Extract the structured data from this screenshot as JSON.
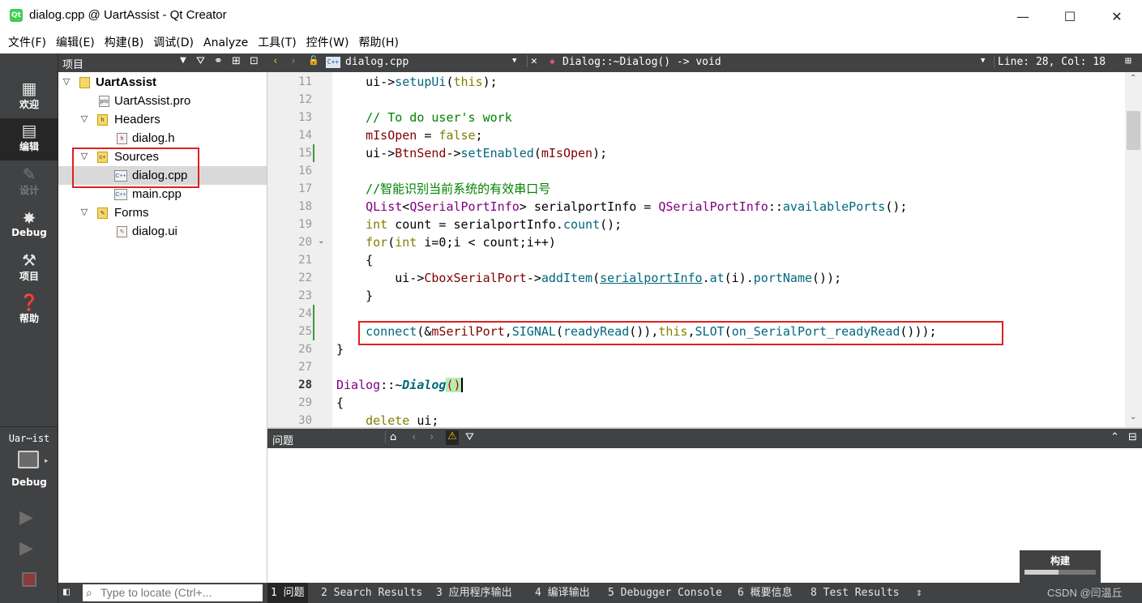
{
  "window": {
    "title": "dialog.cpp @ UartAssist - Qt Creator",
    "app_icon": "Qt",
    "minimize": "—",
    "maximize": "☐",
    "close": "✕"
  },
  "menu": [
    "文件(F)",
    "编辑(E)",
    "构建(B)",
    "调试(D)",
    "Analyze",
    "工具(T)",
    "控件(W)",
    "帮助(H)"
  ],
  "modes": [
    {
      "label": "欢迎",
      "icon": "grid-icon"
    },
    {
      "label": "编辑",
      "icon": "document-icon"
    },
    {
      "label": "设计",
      "icon": "pencil-icon"
    },
    {
      "label": "Debug",
      "icon": "bug-icon"
    },
    {
      "label": "项目",
      "icon": "wrench-icon"
    },
    {
      "label": "帮助",
      "icon": "help-icon"
    }
  ],
  "kit": {
    "project": "Uar⋯ist",
    "config": "Debug"
  },
  "project_pane": {
    "title": "项目"
  },
  "tree": [
    {
      "label": "UartAssist",
      "bold": true
    },
    {
      "label": "UartAssist.pro"
    },
    {
      "label": "Headers"
    },
    {
      "label": "dialog.h"
    },
    {
      "label": "Sources"
    },
    {
      "label": "dialog.cpp"
    },
    {
      "label": "main.cpp"
    },
    {
      "label": "Forms"
    },
    {
      "label": "dialog.ui"
    }
  ],
  "editor": {
    "file": "dialog.cpp",
    "symbol": "Dialog::~Dialog() -> void",
    "position": "Line: 28, Col: 18",
    "line_numbers": [
      "11",
      "12",
      "13",
      "14",
      "15",
      "16",
      "17",
      "18",
      "19",
      "20",
      "21",
      "22",
      "23",
      "24",
      "25",
      "26",
      "27",
      "28",
      "29",
      "30"
    ],
    "current_line": "28"
  },
  "issues": {
    "title": "问题"
  },
  "build_widget": {
    "label": "构建"
  },
  "status": {
    "locate_placeholder": "Type to locate (Ctrl+...",
    "tabs": [
      "1 问题",
      "2 Search Results",
      "3 应用程序输出",
      "4 编译输出",
      "5 Debugger Console",
      "6 概要信息",
      "8 Test Results"
    ],
    "more": "⇕",
    "watermark": "CSDN @闫温丘"
  },
  "colors": {
    "accent_highlight": "#e02020",
    "sidebar_bg": "#404244",
    "keyword": "#808000",
    "comment": "#008000",
    "function": "#00677c",
    "type": "#800080"
  }
}
